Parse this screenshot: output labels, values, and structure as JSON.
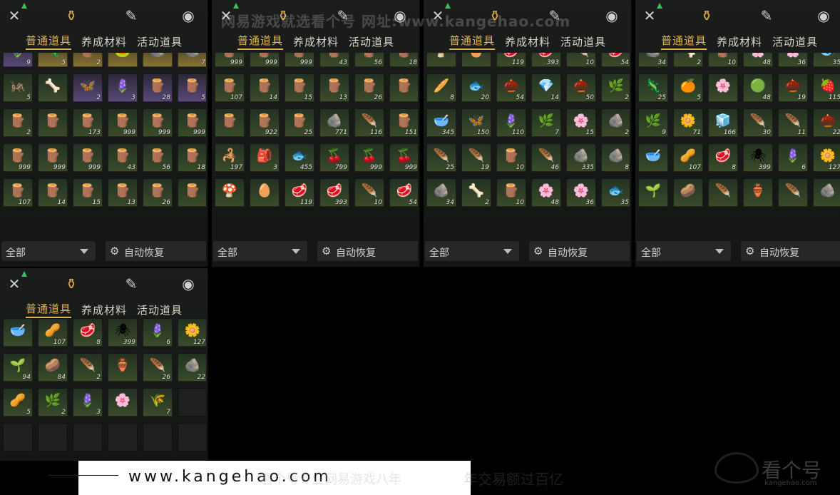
{
  "tabs": [
    "普通道具",
    "养成材料",
    "活动道具"
  ],
  "filter_label": "全部",
  "auto_restore_label": "自动恢复",
  "watermark_top": "网易游戏就选看个号  网址:www.kangehao.com",
  "footer_url": "www.kangehao.com",
  "footer_slogan": "看个号专业网易游戏八年",
  "footer_slogan2": "年交易额过百亿",
  "logo_text": "看个号",
  "logo_sub": "kangehao.com",
  "icons": {
    "weapons": "crossed-swords-icon",
    "bag": "bag-icon",
    "scroll": "scroll-icon",
    "other": "location-pin-icon"
  },
  "panels": [
    {
      "name": "panel-1",
      "rows": [
        [
          {
            "q": "p",
            "i": "🪻",
            "n": "9"
          },
          {
            "q": "g",
            "i": "🦎",
            "n": "5"
          },
          {
            "q": "g",
            "i": "🪵",
            "n": "2"
          },
          {
            "q": "g",
            "i": "🐸",
            "n": ""
          },
          {
            "q": "g",
            "i": "🪨",
            "n": ""
          },
          {
            "q": "g",
            "i": "🪨",
            "n": "7"
          }
        ],
        [
          {
            "q": "",
            "i": "🦗",
            "n": "5"
          },
          {
            "q": "",
            "i": "🦴",
            "n": ""
          },
          {
            "q": "p",
            "i": "🦋",
            "n": "2"
          },
          {
            "q": "p",
            "i": "🪻",
            "n": "3"
          },
          {
            "q": "p",
            "i": "🪵",
            "n": "28"
          },
          {
            "q": "p",
            "i": "🪵",
            "n": "5"
          }
        ],
        [
          {
            "q": "",
            "i": "🪵",
            "n": "2"
          },
          {
            "q": "",
            "i": "🪵",
            "n": ""
          },
          {
            "q": "",
            "i": "🪵",
            "n": "173"
          },
          {
            "q": "",
            "i": "🪵",
            "n": "999"
          },
          {
            "q": "",
            "i": "🪵",
            "n": "999"
          },
          {
            "q": "",
            "i": "🪵",
            "n": "999"
          }
        ],
        [
          {
            "q": "",
            "i": "🪵",
            "n": "999"
          },
          {
            "q": "",
            "i": "🪵",
            "n": "999"
          },
          {
            "q": "",
            "i": "🪵",
            "n": "999"
          },
          {
            "q": "",
            "i": "🪵",
            "n": "43"
          },
          {
            "q": "",
            "i": "🪵",
            "n": "56"
          },
          {
            "q": "",
            "i": "🪵",
            "n": "18"
          }
        ],
        [
          {
            "q": "",
            "i": "🪵",
            "n": "107"
          },
          {
            "q": "",
            "i": "🪵",
            "n": "14"
          },
          {
            "q": "",
            "i": "🪵",
            "n": "15"
          },
          {
            "q": "",
            "i": "🪵",
            "n": "13"
          },
          {
            "q": "",
            "i": "🪵",
            "n": "26"
          },
          {
            "q": "",
            "i": "🪵",
            "n": ""
          }
        ]
      ]
    },
    {
      "name": "panel-2",
      "rows": [
        [
          {
            "q": "",
            "i": "🪵",
            "n": "999"
          },
          {
            "q": "",
            "i": "🪵",
            "n": "999"
          },
          {
            "q": "",
            "i": "🪵",
            "n": "999"
          },
          {
            "q": "",
            "i": "🪵",
            "n": "43"
          },
          {
            "q": "",
            "i": "🪵",
            "n": "56"
          },
          {
            "q": "",
            "i": "🪵",
            "n": "18"
          }
        ],
        [
          {
            "q": "",
            "i": "🪵",
            "n": "107"
          },
          {
            "q": "",
            "i": "🪵",
            "n": "14"
          },
          {
            "q": "",
            "i": "🪵",
            "n": "15"
          },
          {
            "q": "",
            "i": "🪵",
            "n": "13"
          },
          {
            "q": "",
            "i": "🪵",
            "n": "26"
          },
          {
            "q": "",
            "i": "🪵",
            "n": ""
          }
        ],
        [
          {
            "q": "",
            "i": "🪵",
            "n": ""
          },
          {
            "q": "",
            "i": "🪵",
            "n": "922"
          },
          {
            "q": "",
            "i": "🪵",
            "n": "25"
          },
          {
            "q": "",
            "i": "🪨",
            "n": "771"
          },
          {
            "q": "",
            "i": "🪶",
            "n": "116"
          },
          {
            "q": "",
            "i": "🪵",
            "n": "151"
          }
        ],
        [
          {
            "q": "",
            "i": "🦂",
            "n": "197"
          },
          {
            "q": "",
            "i": "🎒",
            "n": "3"
          },
          {
            "q": "",
            "i": "🐟",
            "n": "455"
          },
          {
            "q": "",
            "i": "🍒",
            "n": "799"
          },
          {
            "q": "",
            "i": "🍒",
            "n": "999"
          },
          {
            "q": "",
            "i": "🍒",
            "n": "999"
          }
        ],
        [
          {
            "q": "",
            "i": "🍄",
            "n": ""
          },
          {
            "q": "",
            "i": "🥚",
            "n": ""
          },
          {
            "q": "",
            "i": "🥩",
            "n": "119"
          },
          {
            "q": "",
            "i": "🥩",
            "n": "393"
          },
          {
            "q": "",
            "i": "🪶",
            "n": "10"
          },
          {
            "q": "",
            "i": "🥩",
            "n": "54"
          }
        ]
      ]
    },
    {
      "name": "panel-3",
      "rows": [
        [
          {
            "q": "",
            "i": "🍄",
            "n": ""
          },
          {
            "q": "",
            "i": "🥚",
            "n": ""
          },
          {
            "q": "",
            "i": "🥩",
            "n": "119"
          },
          {
            "q": "",
            "i": "🥩",
            "n": "393"
          },
          {
            "q": "",
            "i": "🪶",
            "n": "10"
          },
          {
            "q": "",
            "i": "🥩",
            "n": "54"
          }
        ],
        [
          {
            "q": "",
            "i": "🥖",
            "n": "8"
          },
          {
            "q": "",
            "i": "🐟",
            "n": "20"
          },
          {
            "q": "",
            "i": "🌰",
            "n": "54"
          },
          {
            "q": "",
            "i": "💎",
            "n": "14"
          },
          {
            "q": "",
            "i": "🌰",
            "n": "50"
          },
          {
            "q": "",
            "i": "🌿",
            "n": "2"
          }
        ],
        [
          {
            "q": "",
            "i": "🥣",
            "n": "345"
          },
          {
            "q": "",
            "i": "🦋",
            "n": "150"
          },
          {
            "q": "",
            "i": "🪻",
            "n": "110"
          },
          {
            "q": "",
            "i": "🌿",
            "n": "7"
          },
          {
            "q": "",
            "i": "🌸",
            "n": "15"
          },
          {
            "q": "",
            "i": "🪨",
            "n": "2"
          }
        ],
        [
          {
            "q": "",
            "i": "🪶",
            "n": "25"
          },
          {
            "q": "",
            "i": "🪶",
            "n": "19"
          },
          {
            "q": "",
            "i": "🪵",
            "n": "10"
          },
          {
            "q": "",
            "i": "🪶",
            "n": "46"
          },
          {
            "q": "",
            "i": "🪨",
            "n": "335"
          },
          {
            "q": "",
            "i": "🪨",
            "n": "8"
          }
        ],
        [
          {
            "q": "",
            "i": "🪨",
            "n": "34"
          },
          {
            "q": "",
            "i": "🦴",
            "n": "2"
          },
          {
            "q": "",
            "i": "🪵",
            "n": "10"
          },
          {
            "q": "",
            "i": "🌸",
            "n": "48"
          },
          {
            "q": "",
            "i": "🌸",
            "n": "36"
          },
          {
            "q": "",
            "i": "🐟",
            "n": "35"
          }
        ]
      ]
    },
    {
      "name": "panel-4",
      "rows": [
        [
          {
            "q": "",
            "i": "🪨",
            "n": "34"
          },
          {
            "q": "",
            "i": "🦴",
            "n": "2"
          },
          {
            "q": "",
            "i": "🪵",
            "n": "10"
          },
          {
            "q": "",
            "i": "🌸",
            "n": "48"
          },
          {
            "q": "",
            "i": "🌸",
            "n": "36"
          },
          {
            "q": "",
            "i": "🐟",
            "n": "35"
          }
        ],
        [
          {
            "q": "",
            "i": "🦎",
            "n": "25"
          },
          {
            "q": "",
            "i": "🍊",
            "n": "5"
          },
          {
            "q": "",
            "i": "🌸",
            "n": ""
          },
          {
            "q": "",
            "i": "🟢",
            "n": "48"
          },
          {
            "q": "",
            "i": "🌰",
            "n": "19"
          },
          {
            "q": "",
            "i": "🍓",
            "n": "115"
          }
        ],
        [
          {
            "q": "",
            "i": "🌿",
            "n": "9"
          },
          {
            "q": "",
            "i": "🌼",
            "n": "71"
          },
          {
            "q": "",
            "i": "🧊",
            "n": "166"
          },
          {
            "q": "",
            "i": "🪶",
            "n": "30"
          },
          {
            "q": "",
            "i": "🪶",
            "n": "11"
          },
          {
            "q": "",
            "i": "🌰",
            "n": "22"
          }
        ],
        [
          {
            "q": "",
            "i": "🥣",
            "n": ""
          },
          {
            "q": "",
            "i": "🥜",
            "n": "107"
          },
          {
            "q": "",
            "i": "🥩",
            "n": "8"
          },
          {
            "q": "",
            "i": "🕷",
            "n": "399"
          },
          {
            "q": "",
            "i": "🪻",
            "n": "6"
          },
          {
            "q": "",
            "i": "🌼",
            "n": "127"
          }
        ],
        [
          {
            "q": "",
            "i": "🌱",
            "n": ""
          },
          {
            "q": "",
            "i": "🥔",
            "n": ""
          },
          {
            "q": "",
            "i": "🪶",
            "n": ""
          },
          {
            "q": "",
            "i": "🏺",
            "n": ""
          },
          {
            "q": "",
            "i": "🪶",
            "n": ""
          },
          {
            "q": "",
            "i": "🪨",
            "n": ""
          }
        ]
      ]
    },
    {
      "name": "panel-5",
      "rows": [
        [
          {
            "q": "",
            "i": "🥣",
            "n": ""
          },
          {
            "q": "",
            "i": "🥜",
            "n": "107"
          },
          {
            "q": "",
            "i": "🥩",
            "n": "8"
          },
          {
            "q": "",
            "i": "🕷",
            "n": "399"
          },
          {
            "q": "",
            "i": "🪻",
            "n": "6"
          },
          {
            "q": "",
            "i": "🌼",
            "n": "127"
          }
        ],
        [
          {
            "q": "",
            "i": "🌱",
            "n": "94"
          },
          {
            "q": "",
            "i": "🥔",
            "n": "84"
          },
          {
            "q": "",
            "i": "🪶",
            "n": "2"
          },
          {
            "q": "",
            "i": "🏺",
            "n": ""
          },
          {
            "q": "",
            "i": "🪶",
            "n": "26"
          },
          {
            "q": "",
            "i": "🪨",
            "n": "22"
          }
        ],
        [
          {
            "q": "",
            "i": "🥜",
            "n": "5"
          },
          {
            "q": "",
            "i": "🌿",
            "n": "2"
          },
          {
            "q": "",
            "i": "🪻",
            "n": "3"
          },
          {
            "q": "",
            "i": "🌸",
            "n": ""
          },
          {
            "q": "",
            "i": "🌾",
            "n": "7"
          },
          {
            "q": "e",
            "i": "",
            "n": ""
          }
        ],
        [
          {
            "q": "e",
            "i": "",
            "n": ""
          },
          {
            "q": "e",
            "i": "",
            "n": ""
          },
          {
            "q": "e",
            "i": "",
            "n": ""
          },
          {
            "q": "e",
            "i": "",
            "n": ""
          },
          {
            "q": "e",
            "i": "",
            "n": ""
          },
          {
            "q": "e",
            "i": "",
            "n": ""
          }
        ],
        [
          {
            "q": "e",
            "i": "",
            "n": ""
          },
          {
            "q": "e",
            "i": "",
            "n": ""
          },
          {
            "q": "e",
            "i": "",
            "n": ""
          },
          {
            "q": "e",
            "i": "",
            "n": ""
          },
          {
            "q": "e",
            "i": "",
            "n": ""
          },
          {
            "q": "e",
            "i": "",
            "n": ""
          }
        ]
      ]
    }
  ]
}
